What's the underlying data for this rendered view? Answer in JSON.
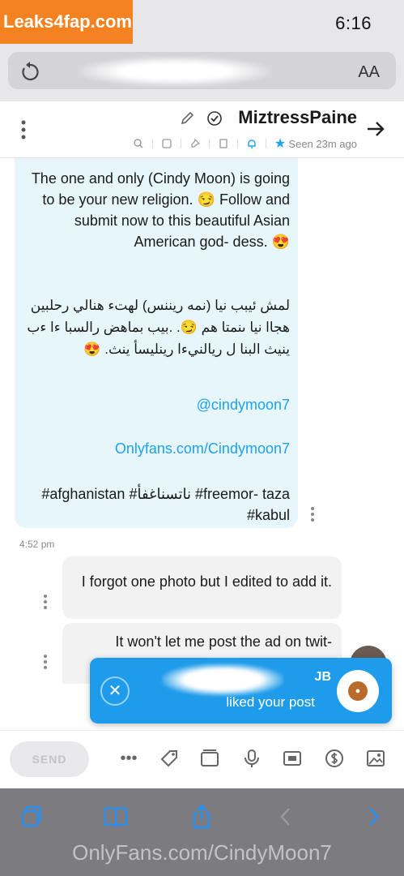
{
  "watermark": "Leaks4fap.com",
  "status": {
    "time": "6:16"
  },
  "browser": {
    "text_size_label": "AA"
  },
  "chat": {
    "username": "MiztressPaine",
    "last_seen": "Seen 23m ago",
    "messages": [
      {
        "text": "The one and only (Cindy Moon) is going to be your new religion. 😏 Follow and submit now to this beautiful Asian American god- dess. 😍"
      },
      {
        "text": "لمش ئيبب نيا (نمه ريننس) لهتء هنالي رحلبين هجاا نيا ىنمتا هم 😏. .بيب بماهض رالسبا ءا ءب ينيث البنا ل ريالنيءا رينليسأ ينث. 😍"
      },
      {
        "link1": "@cindymoon7",
        "link2": "Onlyfans.com/Cindymoon7",
        "tags": "#afghanistan #ناتسناغفأ #freemor- taza #kabul"
      },
      {
        "time": "4:52 pm"
      },
      {
        "text": "I forgot one photo but I edited to add it."
      },
      {
        "text": "It won't let me post the ad on twit-"
      }
    ]
  },
  "toast": {
    "name": "JB",
    "action": "liked your post"
  },
  "composer": {
    "send_label": "SEND"
  },
  "safari": {
    "url_text": "OnlyFans.com/CindyMoon7"
  }
}
